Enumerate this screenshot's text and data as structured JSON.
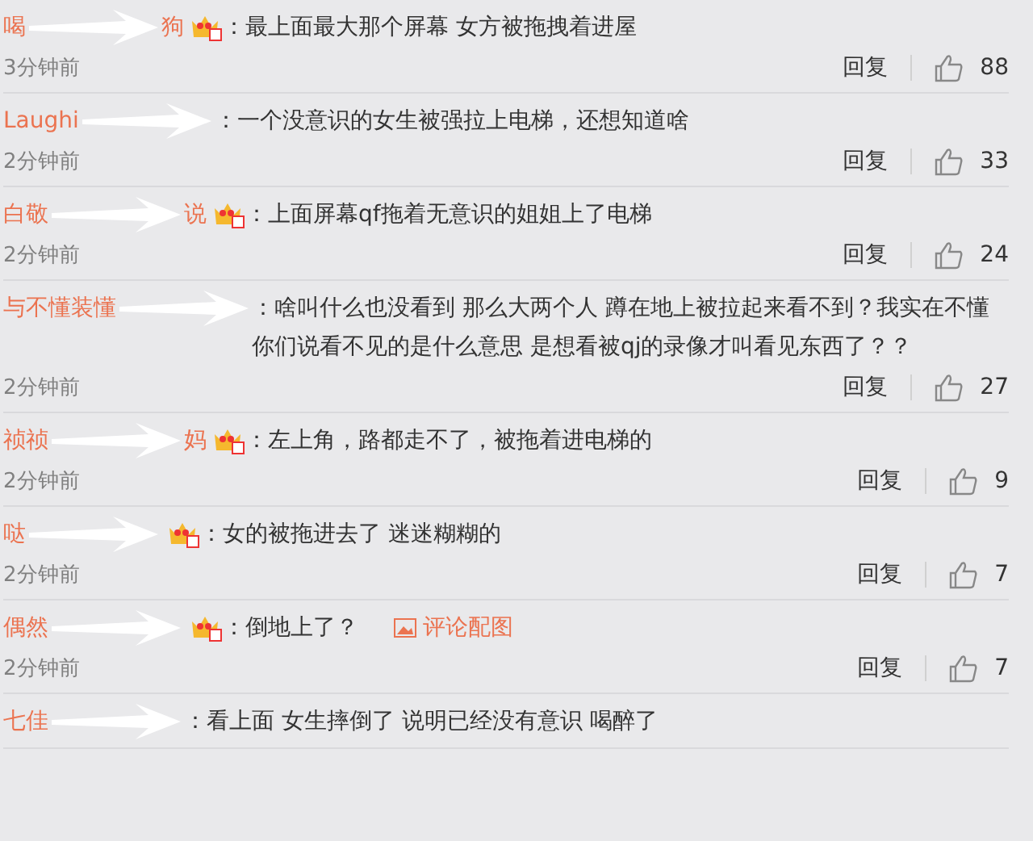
{
  "comments": [
    {
      "name_start": "喝",
      "name_end": "狗",
      "vip": true,
      "text": "：最上面最大那个屏幕 女方被拖拽着进屋",
      "time": "3分钟前",
      "reply": "回复",
      "likes": "88"
    },
    {
      "name_start": "Laughi",
      "vip": false,
      "text": "：一个没意识的女生被强拉上电梯，还想知道啥",
      "time": "2分钟前",
      "reply": "回复",
      "likes": "33"
    },
    {
      "name_start": "白敬",
      "name_end": "说",
      "vip": true,
      "text": "：上面屏幕qf拖着无意识的姐姐上了电梯",
      "time": "2分钟前",
      "reply": "回复",
      "likes": "24"
    },
    {
      "name_start": "与不懂装懂",
      "vip": false,
      "text": "：啥叫什么也没看到 那么大两个人 蹲在地上被拉起来看不到？我实在不懂你们说看不见的是什么意思 是想看被qj的录像才叫看见东西了？？",
      "time": "2分钟前",
      "reply": "回复",
      "likes": "27"
    },
    {
      "name_start": "祯祯",
      "name_end": "妈",
      "vip": true,
      "text": "：左上角，路都走不了，被拖着进电梯的",
      "time": "2分钟前",
      "reply": "回复",
      "likes": "9"
    },
    {
      "name_start": "哒",
      "vip": true,
      "text": "：女的被拖进去了 迷迷糊糊的",
      "time": "2分钟前",
      "reply": "回复",
      "likes": "7"
    },
    {
      "name_start": "偶然",
      "vip": true,
      "text": "：倒地上了？",
      "image_link": "评论配图",
      "time": "2分钟前",
      "reply": "回复",
      "likes": "7"
    },
    {
      "name_start": "七佳",
      "vip": false,
      "text": "：看上面 女生摔倒了 说明已经没有意识 喝醉了"
    }
  ]
}
